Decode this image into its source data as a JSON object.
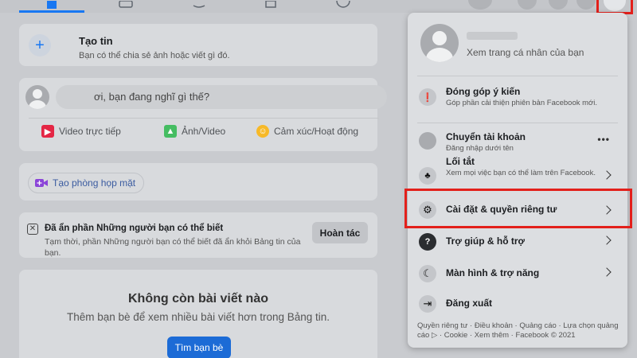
{
  "colors": {
    "accent": "#1877f2",
    "highlight": "#e3201b",
    "find_button": "#1c6bd6"
  },
  "create_story": {
    "title": "Tạo tin",
    "subtitle": "Bạn có thể chia sẻ ảnh hoặc viết gì đó."
  },
  "composer": {
    "placeholder": "ơi, bạn đang nghĩ gì thế?",
    "actions": [
      {
        "label": "Video trực tiếp",
        "icon": "live-video-icon",
        "color": "#e42645"
      },
      {
        "label": "Ảnh/Video",
        "icon": "photo-icon",
        "color": "#45bd62"
      },
      {
        "label": "Cảm xúc/Hoạt động",
        "icon": "feeling-icon",
        "color": "#f7b928"
      }
    ]
  },
  "room": {
    "label": "Tạo phòng họp mặt",
    "icon": "video-room-icon"
  },
  "hidden_notice": {
    "title": "Đã ẩn phần Những người bạn có thể biết",
    "subtitle": "Tạm thời, phần Những người bạn có thể biết đã ẩn khỏi Bảng tin của bạn.",
    "undo_label": "Hoàn tác"
  },
  "no_more": {
    "title": "Không còn bài viết nào",
    "subtitle": "Thêm bạn bè để xem nhiều bài viết hơn trong Bảng tin.",
    "button_label": "Tìm bạn bè"
  },
  "menu": {
    "profile_link": "Xem trang cá nhân của bạn",
    "items": [
      {
        "label": "Đóng góp ý kiến",
        "desc": "Góp phần cải thiện phiên bản Facebook mới.",
        "icon": "feedback-icon",
        "trailing": "none"
      },
      {
        "label": "Chuyển tài khoản",
        "desc": "Đăng nhập dưới tên",
        "icon": "account-icon",
        "trailing": "dots"
      },
      {
        "label": "Lối tắt",
        "desc": "Xem mọi việc bạn có thể làm trên Facebook.",
        "icon": "shortcuts-icon",
        "trailing": "chevron"
      },
      {
        "label": "Cài đặt & quyền riêng tư",
        "desc": "",
        "icon": "settings-gear-icon",
        "trailing": "chevron",
        "highlighted": true
      },
      {
        "label": "Trợ giúp & hỗ trợ",
        "desc": "",
        "icon": "help-icon",
        "trailing": "chevron"
      },
      {
        "label": "Màn hình & trợ năng",
        "desc": "",
        "icon": "moon-icon",
        "trailing": "chevron"
      },
      {
        "label": "Đăng xuất",
        "desc": "",
        "icon": "logout-icon",
        "trailing": "none"
      }
    ],
    "footer": "Quyền riêng tư · Điều khoản · Quảng cáo · Lựa chọn quảng cáo ▷ · Cookie · Xem thêm · Facebook © 2021"
  }
}
